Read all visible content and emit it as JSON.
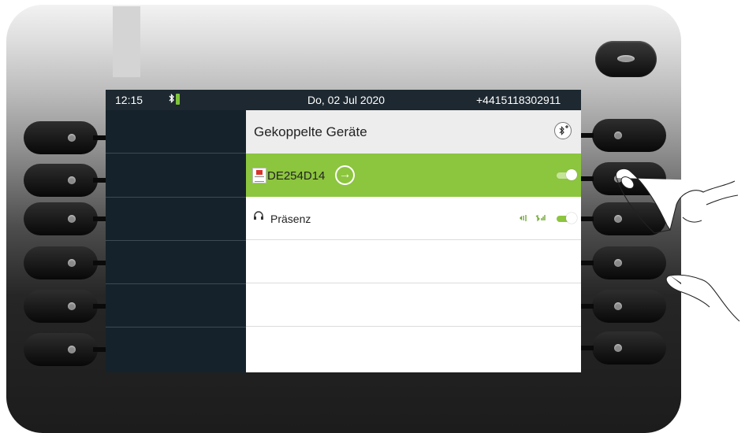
{
  "status_bar": {
    "time": "12:15",
    "bluetooth_icon": "bluetooth-battery-icon",
    "date": "Do, 02 Jul 2020",
    "phone_number": "+4415118302911"
  },
  "panel": {
    "title": "Gekoppelte Geräte",
    "add_icon": "bluetooth-add-icon"
  },
  "devices": [
    {
      "name": "DE254D14",
      "icon": "device-icon",
      "action_icon": "arrow-right-icon",
      "selected": true,
      "toggle_on": true
    },
    {
      "name": "Präsenz",
      "icon": "headset-icon",
      "selected": false,
      "toggle_on": true,
      "status_icons": [
        "audio-icon",
        "signal-icon"
      ]
    }
  ],
  "colors": {
    "selected_row": "#8cc53e",
    "left_panel": "#15222b",
    "status_bar": "#1d2830",
    "toggle_accent": "#8cc53e"
  }
}
